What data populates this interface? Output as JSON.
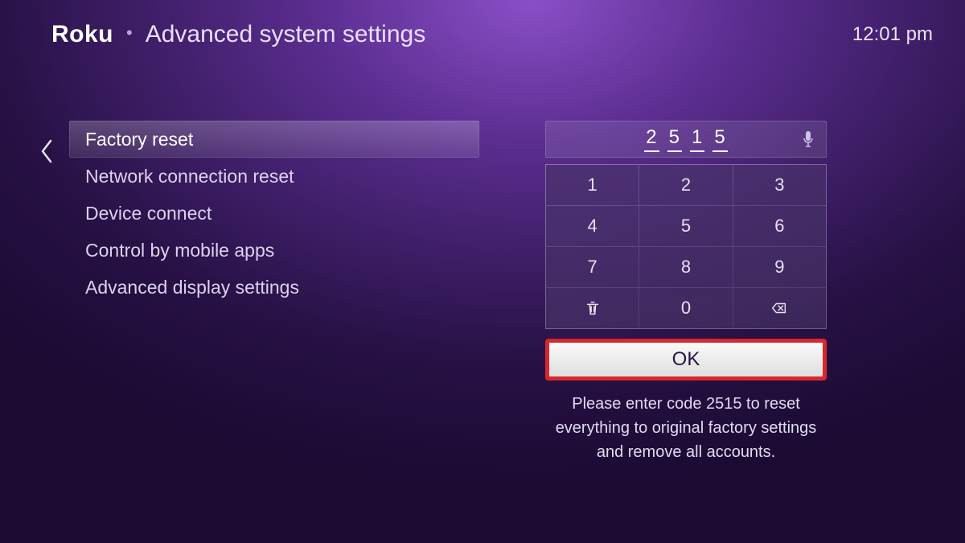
{
  "header": {
    "brand": "Roku",
    "page_title": "Advanced system settings",
    "time": "12:01 pm"
  },
  "menu": {
    "items": [
      {
        "label": "Factory reset",
        "selected": true
      },
      {
        "label": "Network connection reset",
        "selected": false
      },
      {
        "label": "Device connect",
        "selected": false
      },
      {
        "label": "Control by mobile apps",
        "selected": false
      },
      {
        "label": "Advanced display settings",
        "selected": false
      }
    ]
  },
  "input": {
    "entered_code": [
      "2",
      "5",
      "1",
      "5"
    ]
  },
  "keypad": {
    "keys": [
      "1",
      "2",
      "3",
      "4",
      "5",
      "6",
      "7",
      "8",
      "9",
      "trash",
      "0",
      "backspace"
    ]
  },
  "ok_button": {
    "label": "OK"
  },
  "hint": "Please enter code 2515 to reset everything to original factory settings and remove all accounts."
}
